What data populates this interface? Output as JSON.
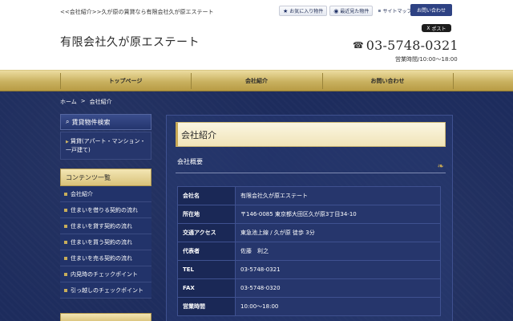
{
  "header": {
    "tagline": "<<会社紹介>>久が原の賃貸なら有限会社久が原エステート",
    "site_title": "有限会社久が原エステート",
    "links": {
      "favorites": "お気に入り物件",
      "recent": "最近見た物件",
      "sitemap": "サイトマップ"
    },
    "contact_button": "お問い合わせ",
    "post_button": "ポスト",
    "phone": "03-5748-0321",
    "hours": "営業時間/10:00～18:00"
  },
  "nav": {
    "items": [
      {
        "label": "トップページ"
      },
      {
        "label": "会社紹介"
      },
      {
        "label": "お問い合わせ"
      }
    ]
  },
  "breadcrumb": {
    "home": "ホーム",
    "separator": ">",
    "current": "会社紹介"
  },
  "sidebar": {
    "search_heading": "賃貸物件検索",
    "search_item": "賃貸(アパート・マンション・一戸建て)",
    "contents_heading": "コンテンツ一覧",
    "items": [
      {
        "label": "会社紹介"
      },
      {
        "label": "住まいを借りる契約の流れ"
      },
      {
        "label": "住まいを貸す契約の流れ"
      },
      {
        "label": "住まいを買う契約の流れ"
      },
      {
        "label": "住まいを売る契約の流れ"
      },
      {
        "label": "内見時のチェックポイント"
      },
      {
        "label": "引っ越しのチェックポイント"
      }
    ]
  },
  "content": {
    "title": "会社紹介",
    "section": "会社概要",
    "rows": [
      {
        "key": "会社名",
        "value": "有限会社久が原エステート"
      },
      {
        "key": "所在地",
        "value": "〒146-0085 東京都大田区久が原3丁目34-10"
      },
      {
        "key": "交通アクセス",
        "value": "東急池上線 / 久が原 徒歩 3分"
      },
      {
        "key": "代表者",
        "value": "佐藤　利之"
      },
      {
        "key": "TEL",
        "value": "03-5748-0321"
      },
      {
        "key": "FAX",
        "value": "03-5748-0320"
      },
      {
        "key": "営業時間",
        "value": "10:00～18:00"
      }
    ]
  },
  "icons": {
    "favorites": "star-icon",
    "recent": "eye-icon",
    "phone": "phone-icon"
  },
  "colors": {
    "navy": "#1d2c5d",
    "gold": "#c9b160",
    "accent_blue": "#2e4283"
  }
}
